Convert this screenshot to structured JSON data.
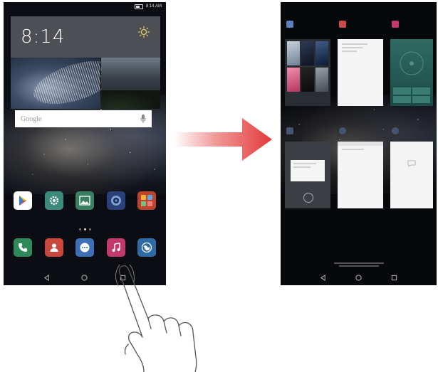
{
  "home_screen": {
    "status_time": "8:14 AM",
    "clock_time": "8:14",
    "search_placeholder": "Google"
  },
  "colors": {
    "arrow_red": "#e33b3b",
    "app_play_bg": "#ffffff",
    "app_settings_bg": "#3c8a7a",
    "app_gallery_bg": "#3a7f61",
    "app_camera_bg": "#2b3f78",
    "app_tools_bg": "#c0442c",
    "dock_phone_bg": "#2e8a58",
    "dock_contacts_bg": "#c9473d",
    "dock_messages_bg": "#3c6fb5",
    "dock_music_bg": "#c2396b",
    "dock_browser_bg": "#2d6aa6"
  },
  "icons": {
    "home_apps": [
      "play-store-icon",
      "settings-icon",
      "gallery-icon",
      "camera-icon",
      "tools-folder-icon"
    ],
    "dock": [
      "phone-icon",
      "contacts-icon",
      "messages-icon",
      "music-icon",
      "browser-icon"
    ],
    "nav": [
      "back-icon",
      "home-icon",
      "recent-apps-icon"
    ]
  }
}
